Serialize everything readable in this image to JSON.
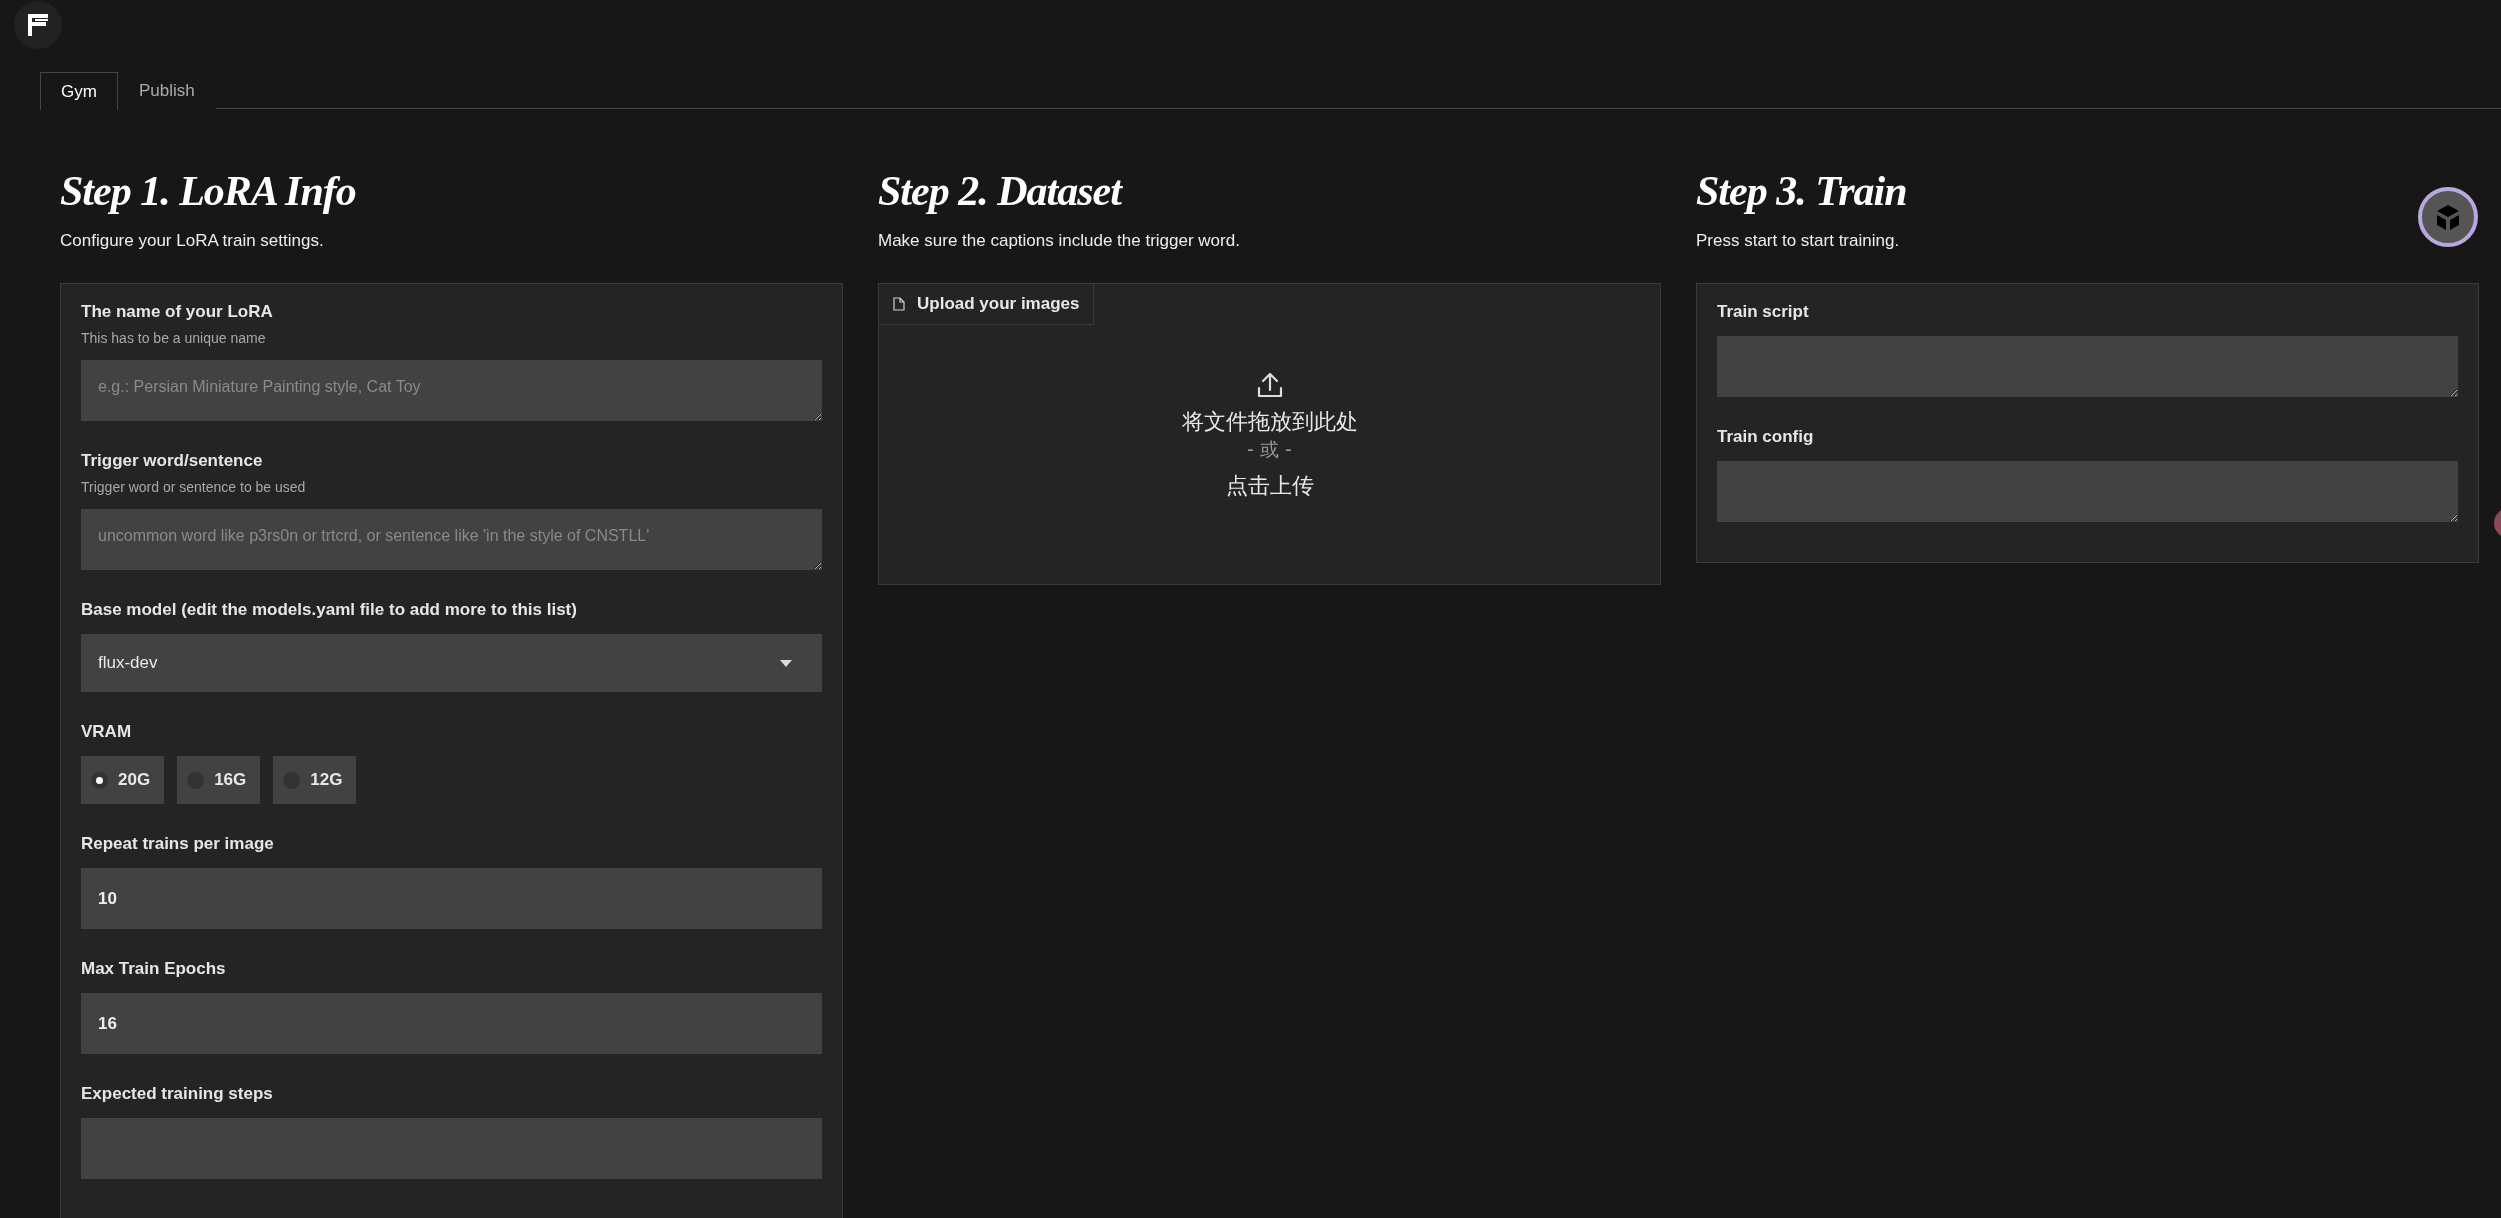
{
  "tabs": [
    {
      "label": "Gym",
      "selected": true
    },
    {
      "label": "Publish",
      "selected": false
    }
  ],
  "steps": [
    {
      "kind": "form",
      "title": "Step 1. LoRA Info",
      "subtitle": "Configure your LoRA train settings.",
      "fields": [
        {
          "kind": "textarea",
          "label": "The name of your LoRA",
          "hint": "This has to be a unique name",
          "placeholder": "e.g.: Persian Miniature Painting style, Cat Toy"
        },
        {
          "kind": "textarea",
          "label": "Trigger word/sentence",
          "hint": "Trigger word or sentence to be used",
          "placeholder": "uncommon word like p3rs0n or trtcrd, or sentence like 'in the style of CNSTLL'"
        },
        {
          "kind": "dropdown",
          "label": "Base model (edit the models.yaml file to add more to this list)",
          "value": "flux-dev"
        },
        {
          "kind": "radio",
          "label": "VRAM",
          "options": [
            {
              "label": "20G",
              "selected": true
            },
            {
              "label": "16G",
              "selected": false
            },
            {
              "label": "12G",
              "selected": false
            }
          ]
        },
        {
          "kind": "number",
          "label": "Repeat trains per image",
          "value": "10"
        },
        {
          "kind": "number",
          "label": "Max Train Epochs",
          "value": "16"
        },
        {
          "kind": "number",
          "label": "Expected training steps"
        }
      ]
    },
    {
      "kind": "upload",
      "title": "Step 2. Dataset",
      "subtitle": "Make sure the captions include the trigger word.",
      "upload": {
        "label": "Upload your images",
        "drop_text": "将文件拖放到此处",
        "or_text": "- 或 -",
        "click_text": "点击上传"
      }
    },
    {
      "kind": "form",
      "title": "Step 3. Train",
      "subtitle": "Press start to start training.",
      "fields": [
        {
          "kind": "textarea",
          "label": "Train script"
        },
        {
          "kind": "textarea",
          "label": "Train config"
        }
      ]
    }
  ]
}
